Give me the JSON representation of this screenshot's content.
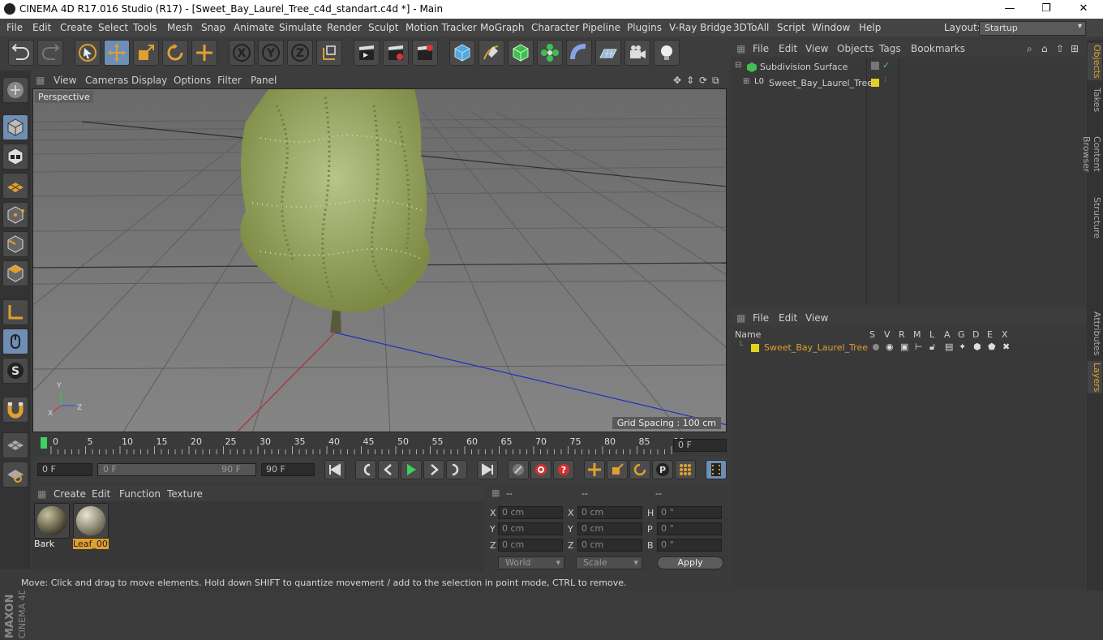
{
  "window": {
    "title": "CINEMA 4D R17.016 Studio (R17) - [Sweet_Bay_Laurel_Tree_c4d_standart.c4d *] - Main",
    "minimize": "—",
    "maximize": "❐",
    "close": "✕"
  },
  "menubar": {
    "items": [
      "File",
      "Edit",
      "Create",
      "Select",
      "Tools",
      "Mesh",
      "Snap",
      "Animate",
      "Simulate",
      "Render",
      "Sculpt",
      "Motion Tracker",
      "MoGraph",
      "Character",
      "Pipeline",
      "Plugins",
      "V-Ray Bridge",
      "3DToAll",
      "Script",
      "Window",
      "Help"
    ],
    "layout_label": "Layout:",
    "layout_value": "Startup"
  },
  "viewport": {
    "menu": [
      "View",
      "Cameras",
      "Display",
      "Options",
      "Filter",
      "Panel"
    ],
    "camera_label": "Perspective",
    "grid_spacing": "Grid Spacing : 100 cm",
    "axis_x": "X",
    "axis_y": "Y",
    "axis_z": "Z"
  },
  "timeline": {
    "ticks": [
      "0",
      "5",
      "10",
      "15",
      "20",
      "25",
      "30",
      "35",
      "40",
      "45",
      "50",
      "55",
      "60",
      "65",
      "70",
      "75",
      "80",
      "85",
      "90"
    ],
    "current_frame": "0 F"
  },
  "transport": {
    "start_frame": "0 F",
    "range_start": "0 F",
    "range_end": "90 F",
    "end_frame": "90 F"
  },
  "materials": {
    "menu": [
      "Create",
      "Edit",
      "Function",
      "Texture"
    ],
    "items": [
      {
        "name": "Bark",
        "selected": false
      },
      {
        "name": "Leaf_00",
        "selected": true
      }
    ]
  },
  "coords": {
    "headers": [
      "--",
      "--",
      "--"
    ],
    "rows": [
      {
        "l1": "X",
        "v1": "0 cm",
        "l2": "X",
        "v2": "0 cm",
        "l3": "H",
        "v3": "0 °"
      },
      {
        "l1": "Y",
        "v1": "0 cm",
        "l2": "Y",
        "v2": "0 cm",
        "l3": "P",
        "v3": "0 °"
      },
      {
        "l1": "Z",
        "v1": "0 cm",
        "l2": "Z",
        "v2": "0 cm",
        "l3": "B",
        "v3": "0 °"
      }
    ],
    "mode": "World",
    "scale": "Scale",
    "apply": "Apply"
  },
  "status": "Move: Click and drag to move elements. Hold down SHIFT to quantize movement / add to the selection in point mode, CTRL to remove.",
  "objects": {
    "menu": [
      "File",
      "Edit",
      "View",
      "Objects",
      "Tags",
      "Bookmarks"
    ],
    "items": [
      {
        "name": "Subdivision Surface",
        "color": "#cfcfcf"
      },
      {
        "name": "Sweet_Bay_Laurel_Tree",
        "color": "#cfcfcf"
      }
    ]
  },
  "layers": {
    "menu": [
      "File",
      "Edit",
      "View"
    ],
    "columns": [
      "Name",
      "S",
      "V",
      "R",
      "M",
      "L",
      "A",
      "G",
      "D",
      "E",
      "X"
    ],
    "items": [
      {
        "name": "Sweet_Bay_Laurel_Tree",
        "color": "#e0c020"
      }
    ]
  },
  "side_tabs": {
    "top": [
      "Objects",
      "Takes",
      "Content Browser",
      "Structure"
    ],
    "bottom": [
      "Attributes",
      "Layers"
    ]
  },
  "brand": {
    "maxon": "MAXON",
    "product": "CINEMA 4D"
  },
  "colors": {
    "accent_orange": "#e0a030",
    "selection_blue": "#6e8eb5",
    "layer_yellow": "#e0d020"
  }
}
